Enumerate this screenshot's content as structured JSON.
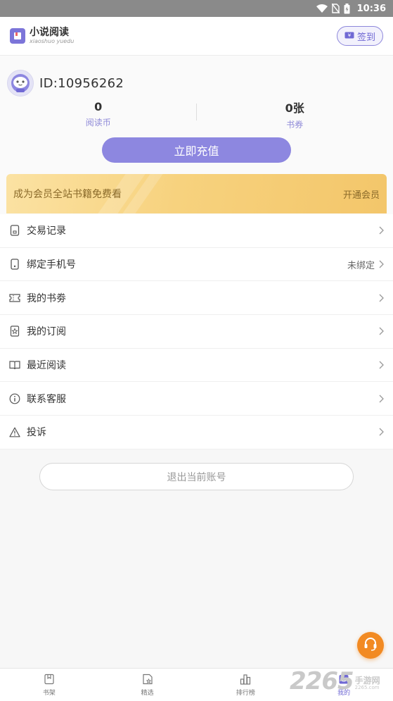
{
  "status_bar": {
    "time": "10:36"
  },
  "header": {
    "logo_title": "小说阅读",
    "logo_subtitle": "xiaoshuo yuedu",
    "signin_label": "签到"
  },
  "profile": {
    "user_id": "ID:10956262",
    "stats": [
      {
        "value": "0",
        "label": "阅读币"
      },
      {
        "value": "0张",
        "label": "书券"
      }
    ],
    "recharge_label": "立即充值",
    "vip_text": "成为会员全站书籍免费看",
    "vip_link": "开通会员"
  },
  "menu": [
    {
      "label": "交易记录",
      "value": "",
      "icon": "receipt-icon"
    },
    {
      "label": "绑定手机号",
      "value": "未绑定",
      "icon": "phone-icon"
    },
    {
      "label": "我的书劵",
      "value": "",
      "icon": "ticket-icon"
    },
    {
      "label": "我的订阅",
      "value": "",
      "icon": "star-page-icon"
    },
    {
      "label": "最近阅读",
      "value": "",
      "icon": "open-book-icon"
    },
    {
      "label": "联系客服",
      "value": "",
      "icon": "info-icon"
    },
    {
      "label": "投诉",
      "value": "",
      "icon": "warning-icon"
    }
  ],
  "logout_label": "退出当前账号",
  "bottom_nav": [
    {
      "label": "书架",
      "icon": "bookshelf-icon",
      "active": false
    },
    {
      "label": "精选",
      "icon": "featured-icon",
      "active": false
    },
    {
      "label": "排行榜",
      "icon": "ranking-icon",
      "active": false
    },
    {
      "label": "我的",
      "icon": "profile-icon",
      "active": true
    }
  ],
  "watermark": {
    "number": "2265",
    "cn": "手游网",
    "domain": "2265.com"
  },
  "colors": {
    "accent": "#8d87e0",
    "vip_gold": "#f7d27e",
    "service_orange": "#f28a22"
  }
}
